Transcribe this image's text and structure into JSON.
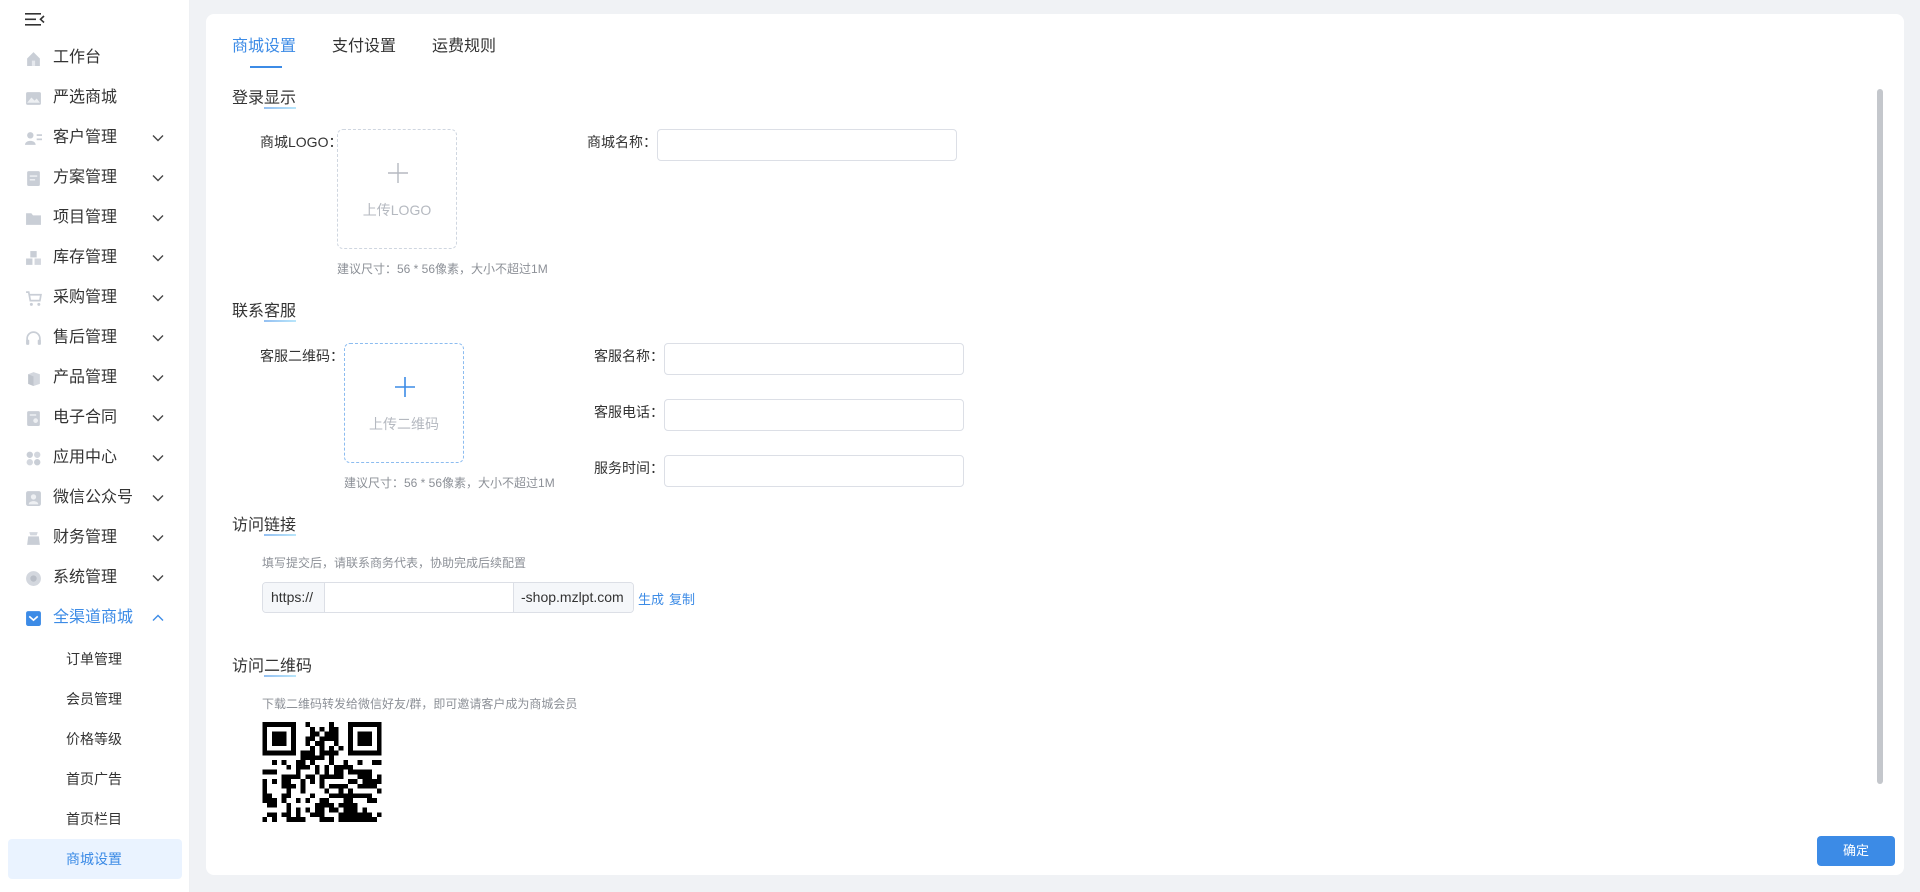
{
  "sidebar": {
    "items": [
      {
        "label": "工作台",
        "icon": "home-icon",
        "expandable": false
      },
      {
        "label": "严选商城",
        "icon": "image-icon",
        "expandable": false
      },
      {
        "label": "客户管理",
        "icon": "user-card-icon",
        "expandable": true
      },
      {
        "label": "方案管理",
        "icon": "document-icon",
        "expandable": true
      },
      {
        "label": "项目管理",
        "icon": "folder-icon",
        "expandable": true
      },
      {
        "label": "库存管理",
        "icon": "boxes-icon",
        "expandable": true
      },
      {
        "label": "采购管理",
        "icon": "cart-icon",
        "expandable": true
      },
      {
        "label": "售后管理",
        "icon": "headset-icon",
        "expandable": true
      },
      {
        "label": "产品管理",
        "icon": "cube-icon",
        "expandable": true
      },
      {
        "label": "电子合同",
        "icon": "contract-icon",
        "expandable": true
      },
      {
        "label": "应用中心",
        "icon": "apps-icon",
        "expandable": true
      },
      {
        "label": "微信公众号",
        "icon": "wechat-user-icon",
        "expandable": true
      },
      {
        "label": "财务管理",
        "icon": "wallet-icon",
        "expandable": true
      },
      {
        "label": "系统管理",
        "icon": "settings-icon",
        "expandable": true
      },
      {
        "label": "全渠道商城",
        "icon": "store-icon",
        "expandable": true,
        "active": true
      }
    ],
    "sub_items": [
      "订单管理",
      "会员管理",
      "价格等级",
      "首页广告",
      "首页栏目",
      "商城设置"
    ],
    "selected_sub_index": 5
  },
  "tabs": [
    {
      "label": "商城设置",
      "active": true
    },
    {
      "label": "支付设置",
      "active": false
    },
    {
      "label": "运费规则",
      "active": false
    }
  ],
  "login_display": {
    "title": "登录显示",
    "logo_label": "商城LOGO：",
    "upload_text": "上传LOGO",
    "hint": "建议尺寸：56 * 56像素，大小不超过1M",
    "name_label": "商城名称：",
    "name_value": ""
  },
  "customer_service": {
    "title": "联系客服",
    "qr_label": "客服二维码：",
    "upload_text": "上传二维码",
    "hint": "建议尺寸：56 * 56像素，大小不超过1M",
    "name_label": "客服名称：",
    "phone_label": "客服电话：",
    "hours_label": "服务时间：",
    "name_value": "",
    "phone_value": "",
    "hours_value": ""
  },
  "access_link": {
    "title": "访问链接",
    "hint": "填写提交后，请联系商务代表，协助完成后续配置",
    "prefix": "https://",
    "value": "",
    "suffix": "-shop.mzlpt.com",
    "generate_label": "生成",
    "copy_label": "复制"
  },
  "access_qr": {
    "title": "访问二维码",
    "hint": "下载二维码转发给微信好友/群，即可邀请客户成为商城会员"
  },
  "footer": {
    "confirm_label": "确定"
  },
  "colors": {
    "accent": "#3c8be6",
    "sidebar_selected_bg": "#eaf3ff",
    "page_bg": "#f0f2f5"
  }
}
